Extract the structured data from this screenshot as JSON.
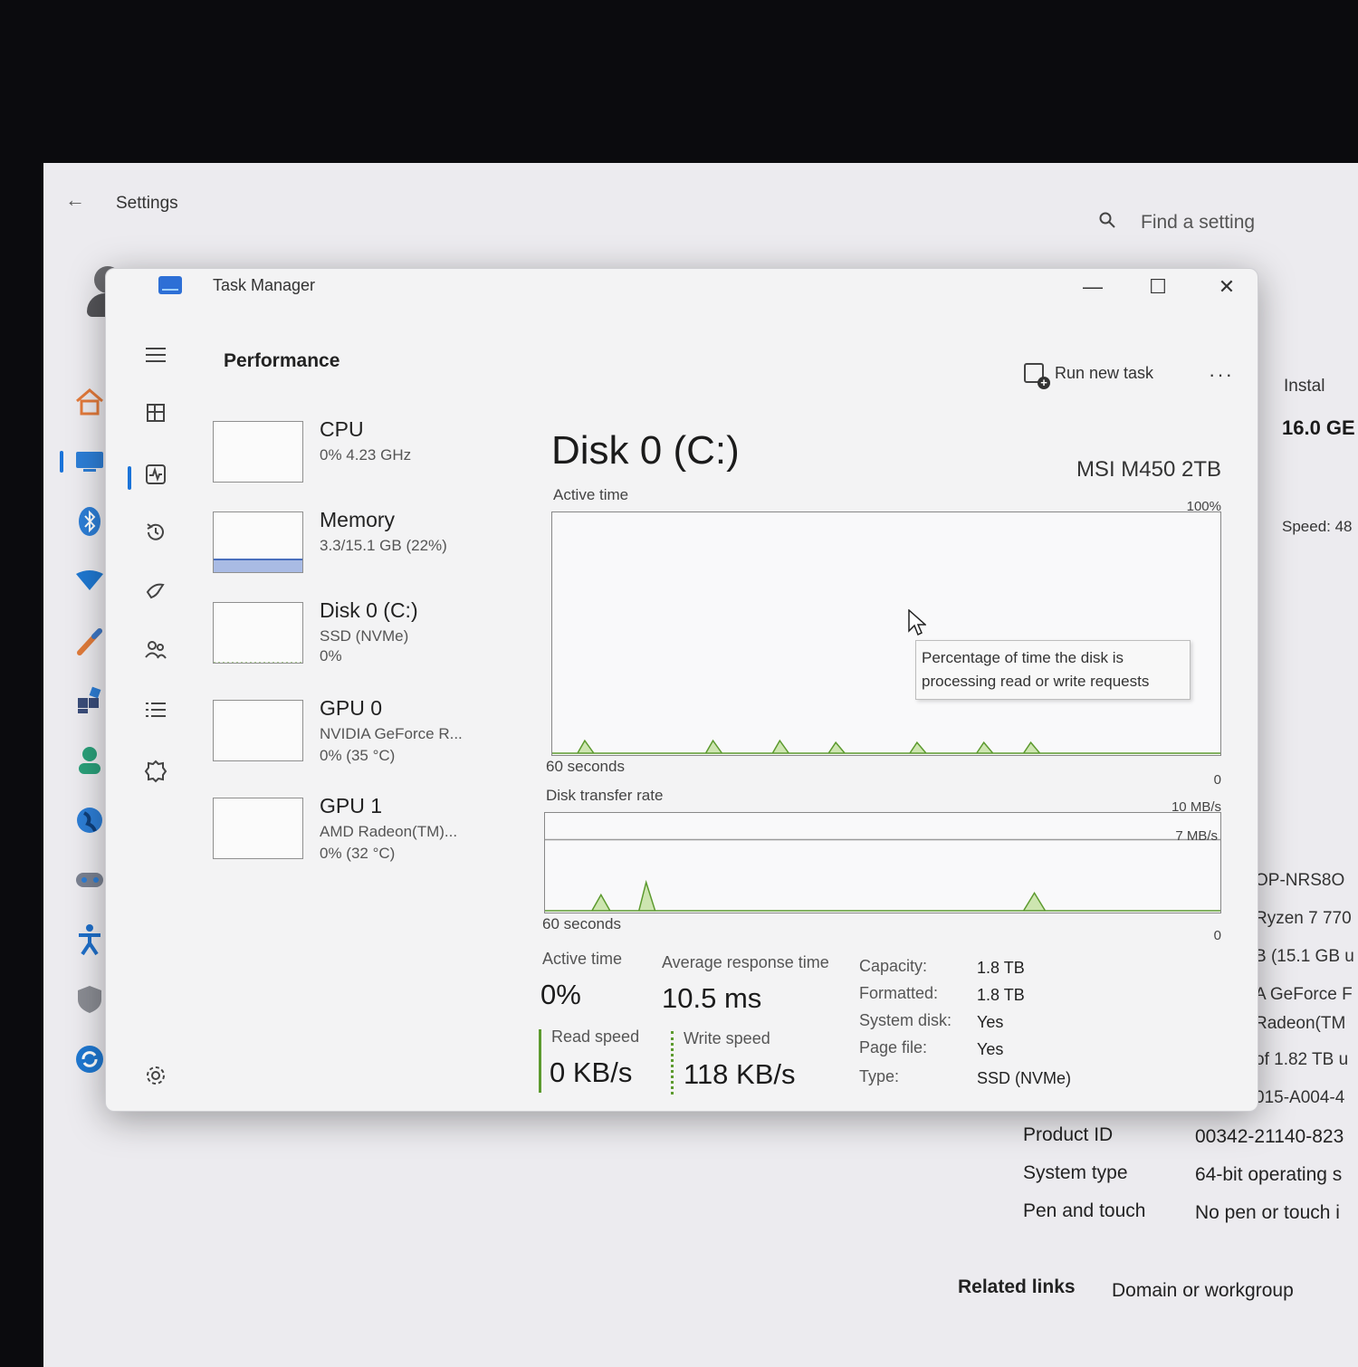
{
  "settings": {
    "back_glyph": "←",
    "title": "Settings",
    "search_placeholder": "Find a setting",
    "right_panel": {
      "installed_label": "Instal",
      "ram_value": "16.0 GE",
      "speed_label": "Speed: 48",
      "device_name": "OP-NRS8O",
      "processor": "Ryzen 7 770",
      "installed_ram": "B (15.1 GB u",
      "graphics_1": "A GeForce F",
      "graphics_2": "Radeon(TM",
      "storage": "of 1.82 TB u",
      "device_id": "015-A004-4",
      "product_id_label": "Product ID",
      "product_id_value": "00342-21140-823",
      "system_type_label": "System type",
      "system_type_value": "64-bit operating s",
      "pen_touch_label": "Pen and touch",
      "pen_touch_value": "No pen or touch i",
      "related_links_label": "Related links",
      "related_link_1": "Domain or workgroup"
    },
    "nav_icons": [
      "home-icon",
      "system-icon",
      "bluetooth-icon",
      "network-icon",
      "personalization-icon",
      "apps-icon",
      "accounts-icon",
      "time-language-icon",
      "gaming-icon",
      "accessibility-icon",
      "privacy-icon",
      "windows-update-icon"
    ]
  },
  "task_manager": {
    "title": "Task Manager",
    "controls": {
      "minimize": "—",
      "maximize": "☐",
      "close": "✕"
    },
    "section": "Performance",
    "run_new_task": "Run new task",
    "more": "···",
    "devices": [
      {
        "name": "CPU",
        "sub1": "0% 4.23 GHz",
        "sub2": "",
        "sub3": "",
        "fill_fraction": 0
      },
      {
        "name": "Memory",
        "sub1": "3.3/15.1 GB (22%)",
        "sub2": "",
        "sub3": "",
        "fill_fraction": 0.22
      },
      {
        "name": "Disk 0 (C:)",
        "sub1": "SSD (NVMe)",
        "sub2": "0%",
        "sub3": "",
        "fill_fraction": 0
      },
      {
        "name": "GPU 0",
        "sub1": "NVIDIA GeForce R...",
        "sub2": "0% (35 °C)",
        "sub3": "",
        "fill_fraction": 0
      },
      {
        "name": "GPU 1",
        "sub1": "AMD Radeon(TM)...",
        "sub2": "0% (32 °C)",
        "sub3": "",
        "fill_fraction": 0
      }
    ],
    "disk": {
      "title": "Disk 0 (C:)",
      "model": "MSI M450 2TB",
      "active_time_graph": {
        "label": "Active time",
        "max_label": "100%",
        "min_label": "0",
        "time_label": "60 seconds"
      },
      "transfer_graph": {
        "label": "Disk transfer rate",
        "max_label": "10 MB/s",
        "line_label": "7 MB/s",
        "min_label": "0",
        "time_label": "60 seconds"
      },
      "tooltip_line1": "Percentage of time the disk is",
      "tooltip_line2": "processing read or write requests",
      "stats": {
        "active_time_label": "Active time",
        "active_time_value": "0%",
        "avg_response_label": "Average response time",
        "avg_response_value": "10.5 ms",
        "read_speed_label": "Read speed",
        "read_speed_value": "0 KB/s",
        "write_speed_label": "Write speed",
        "write_speed_value": "118 KB/s"
      },
      "properties": [
        {
          "key": "Capacity:",
          "value": "1.8 TB"
        },
        {
          "key": "Formatted:",
          "value": "1.8 TB"
        },
        {
          "key": "System disk:",
          "value": "Yes"
        },
        {
          "key": "Page file:",
          "value": "Yes"
        },
        {
          "key": "Type:",
          "value": "SSD (NVMe)"
        }
      ]
    },
    "rail_icons": [
      "hamburger-icon",
      "processes-icon",
      "performance-icon",
      "app-history-icon",
      "startup-apps-icon",
      "users-icon",
      "details-icon",
      "services-icon",
      "settings-icon"
    ]
  },
  "colors": {
    "accent": "#1a73d9",
    "graph_green": "#5c9a2e",
    "graph_fill": "#cde5b0",
    "memory_fill": "#a9bbe4"
  }
}
